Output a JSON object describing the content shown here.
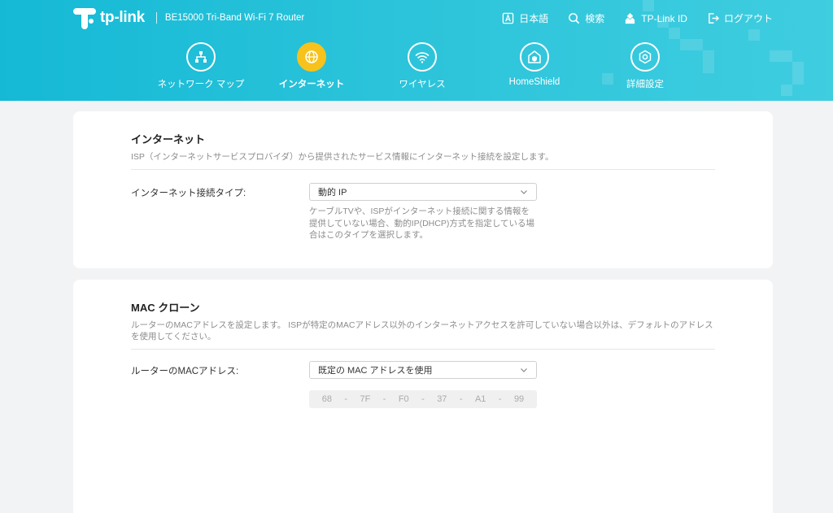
{
  "header": {
    "logo_text": "tp-link",
    "product": "BE15000 Tri-Band Wi-Fi 7 Router",
    "links": [
      {
        "label": "日本語",
        "icon": "language-icon"
      },
      {
        "label": "検索",
        "icon": "search-icon"
      },
      {
        "label": "TP-Link ID",
        "icon": "tplink-id-icon"
      },
      {
        "label": "ログアウト",
        "icon": "logout-icon"
      }
    ]
  },
  "nav": {
    "items": [
      {
        "label": "ネットワーク マップ",
        "icon": "network-map-icon",
        "active": false
      },
      {
        "label": "インターネット",
        "icon": "globe-icon",
        "active": true
      },
      {
        "label": "ワイヤレス",
        "icon": "wifi-icon",
        "active": false
      },
      {
        "label": "HomeShield",
        "icon": "homeshield-icon",
        "active": false
      },
      {
        "label": "詳細設定",
        "icon": "gear-icon",
        "active": false
      }
    ]
  },
  "internet": {
    "title": "インターネット",
    "description": "ISP（インターネットサービスプロバイダ）から提供されたサービス情報にインターネット接続を設定します。",
    "type_label": "インターネット接続タイプ:",
    "type_value": "動的 IP",
    "help": "ケーブルTVや、ISPがインターネット接続に関する情報を提供していない場合、動的IP(DHCP)方式を指定している場合はこのタイプを選択します。"
  },
  "mac_clone": {
    "title": "MAC クローン",
    "description": "ルーターのMACアドレスを設定します。 ISPが特定のMACアドレス以外のインターネットアクセスを許可していない場合以外は、デフォルトのアドレスを使用してください。",
    "mac_label": "ルーターのMACアドレス:",
    "mac_option": "既定の MAC アドレスを使用",
    "mac_octets": [
      "68",
      "7F",
      "F0",
      "37",
      "A1",
      "99"
    ],
    "separator": "-"
  },
  "colors": {
    "header": "#15b9d6",
    "active_nav": "#f7c21b",
    "background": "#f2f3f5"
  }
}
